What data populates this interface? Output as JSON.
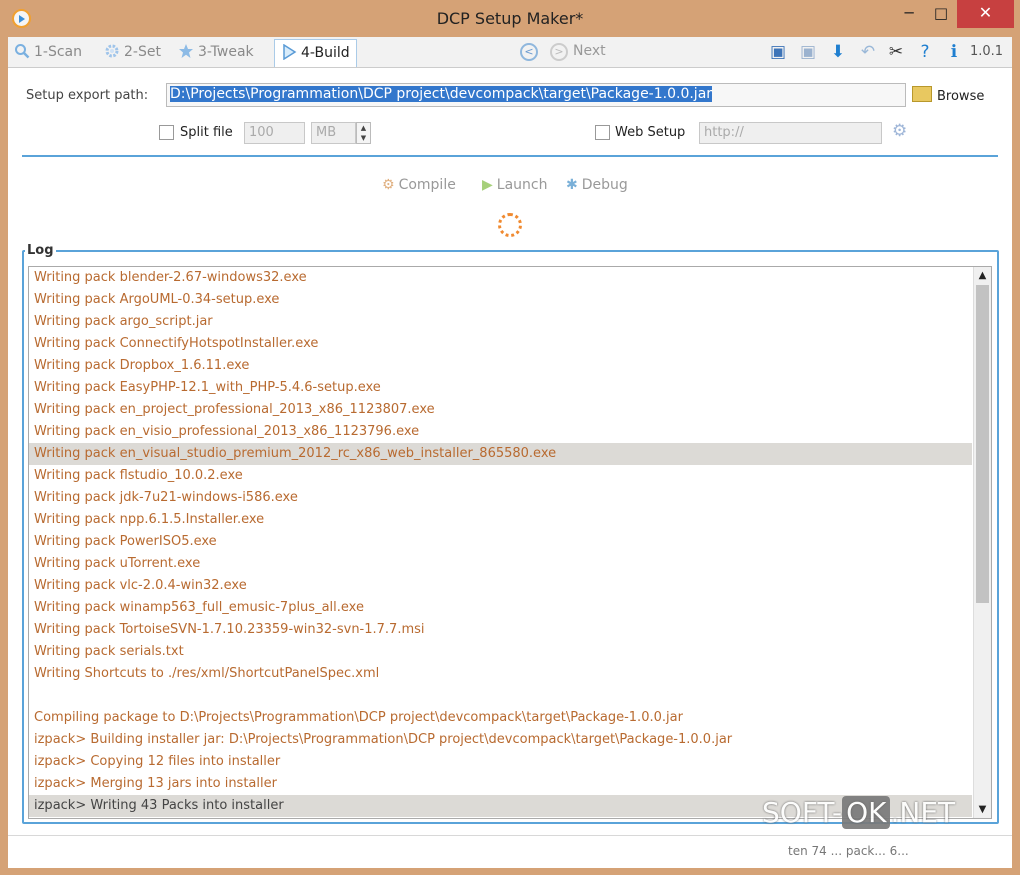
{
  "window": {
    "title": "DCP Setup Maker*",
    "minimize": "─",
    "maximize": "□",
    "close": "✕"
  },
  "toolbar": {
    "tabs": [
      {
        "label": "1-Scan",
        "icon": "search-icon"
      },
      {
        "label": "2-Set",
        "icon": "gear-icon"
      },
      {
        "label": "3-Tweak",
        "icon": "star-icon"
      },
      {
        "label": "4-Build",
        "icon": "play-triangle-icon"
      }
    ],
    "next_label": "Next",
    "version": "1.0.1",
    "colors": {
      "accent": "#5aa3d9",
      "active_tab_border": "#aacbe8"
    }
  },
  "export": {
    "label": "Setup export path:",
    "path": "D:\\Projects\\Programmation\\DCP project\\devcompack\\target\\Package-1.0.0.jar",
    "browse_label": "Browse"
  },
  "split": {
    "label": "Split file",
    "size": "100",
    "unit": "MB"
  },
  "web": {
    "label": "Web Setup",
    "url_placeholder": "http://"
  },
  "actions": {
    "compile": "Compile",
    "launch": "Launch",
    "debug": "Debug"
  },
  "log": {
    "title": "Log",
    "lines": [
      {
        "text": "Writing pack blender-2.67-windows32.exe",
        "sel": false,
        "izp": false
      },
      {
        "text": "Writing pack ArgoUML-0.34-setup.exe",
        "sel": false,
        "izp": false
      },
      {
        "text": "Writing pack argo_script.jar",
        "sel": false,
        "izp": false
      },
      {
        "text": "Writing pack ConnectifyHotspotInstaller.exe",
        "sel": false,
        "izp": false
      },
      {
        "text": "Writing pack Dropbox_1.6.11.exe",
        "sel": false,
        "izp": false
      },
      {
        "text": "Writing pack EasyPHP-12.1_with_PHP-5.4.6-setup.exe",
        "sel": false,
        "izp": false
      },
      {
        "text": "Writing pack en_project_professional_2013_x86_1123807.exe",
        "sel": false,
        "izp": false
      },
      {
        "text": "Writing pack en_visio_professional_2013_x86_1123796.exe",
        "sel": false,
        "izp": false
      },
      {
        "text": "Writing pack en_visual_studio_premium_2012_rc_x86_web_installer_865580.exe",
        "sel": true,
        "izp": false
      },
      {
        "text": "Writing pack flstudio_10.0.2.exe",
        "sel": false,
        "izp": false
      },
      {
        "text": "Writing pack jdk-7u21-windows-i586.exe",
        "sel": false,
        "izp": false
      },
      {
        "text": "Writing pack npp.6.1.5.Installer.exe",
        "sel": false,
        "izp": false
      },
      {
        "text": "Writing pack PowerISO5.exe",
        "sel": false,
        "izp": false
      },
      {
        "text": "Writing pack uTorrent.exe",
        "sel": false,
        "izp": false
      },
      {
        "text": "Writing pack vlc-2.0.4-win32.exe",
        "sel": false,
        "izp": false
      },
      {
        "text": "Writing pack winamp563_full_emusic-7plus_all.exe",
        "sel": false,
        "izp": false
      },
      {
        "text": "Writing pack TortoiseSVN-1.7.10.23359-win32-svn-1.7.7.msi",
        "sel": false,
        "izp": false
      },
      {
        "text": "Writing pack serials.txt",
        "sel": false,
        "izp": false
      },
      {
        "text": "Writing Shortcuts to ./res/xml/ShortcutPanelSpec.xml",
        "sel": false,
        "izp": false
      },
      {
        "text": "",
        "sel": false,
        "izp": false
      },
      {
        "text": "Compiling package to D:\\Projects\\Programmation\\DCP project\\devcompack\\target\\Package-1.0.0.jar",
        "sel": false,
        "izp": false
      },
      {
        "text": "izpack> Building installer jar: D:\\Projects\\Programmation\\DCP project\\devcompack\\target\\Package-1.0.0.jar",
        "sel": false,
        "izp": false
      },
      {
        "text": "izpack> Copying 12 files into installer",
        "sel": false,
        "izp": false
      },
      {
        "text": "izpack> Merging 13 jars into installer",
        "sel": false,
        "izp": false
      },
      {
        "text": "izpack> Writing 43 Packs into installer",
        "sel": true,
        "izp": true
      }
    ]
  },
  "status": {
    "text": "ten 74 ... pack... 6..."
  },
  "watermark": {
    "pre": "SOFT-",
    "box": "OK",
    "post": ".NET"
  }
}
